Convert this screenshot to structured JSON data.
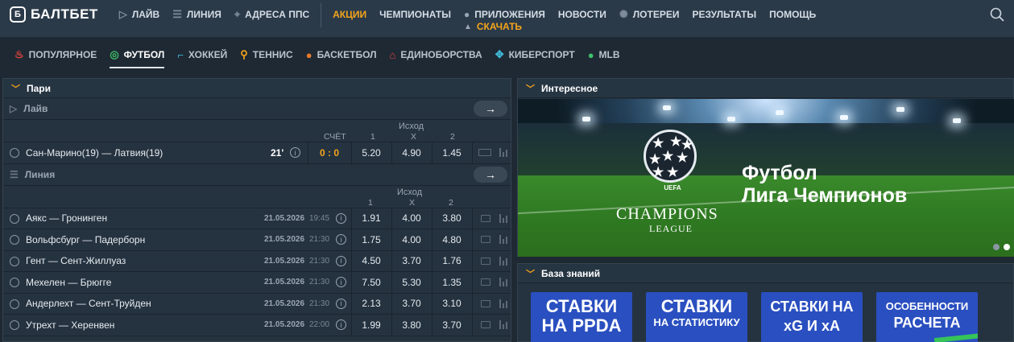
{
  "brand": {
    "logo_letter": "Б",
    "name": "БАЛТБЕТ"
  },
  "topnav": {
    "items": [
      {
        "icon": "play-circle-icon",
        "label": "ЛАЙВ"
      },
      {
        "icon": "list-icon",
        "label": "ЛИНИЯ"
      },
      {
        "icon": "map-pin-icon",
        "label": "АДРЕСА ППС"
      }
    ],
    "items2": [
      {
        "label": "АКЦИИ",
        "accent": true
      },
      {
        "label": "ЧЕМПИОНАТЫ",
        "accent": false
      }
    ],
    "apps": {
      "label": "ПРИЛОЖЕНИЯ",
      "download": "СКАЧАТЬ"
    },
    "items3": [
      {
        "label": "НОВОСТИ"
      },
      {
        "label": "ЛОТЕРЕИ"
      },
      {
        "label": "РЕЗУЛЬТАТЫ"
      },
      {
        "label": "ПОМОЩЬ"
      }
    ]
  },
  "sports": [
    {
      "label": "ПОПУЛЯРНОЕ",
      "icon": "fire-icon",
      "color": "#e8453c",
      "active": false
    },
    {
      "label": "ФУТБОЛ",
      "icon": "soccer-ball-icon",
      "color": "#3fbf6a",
      "active": true
    },
    {
      "label": "ХОККЕЙ",
      "icon": "hockey-icon",
      "color": "#3fb8d8",
      "active": false
    },
    {
      "label": "ТЕННИС",
      "icon": "tennis-racket-icon",
      "color": "#f4a51c",
      "active": false
    },
    {
      "label": "БАСКЕТБОЛ",
      "icon": "basketball-icon",
      "color": "#e87a2c",
      "active": false
    },
    {
      "label": "ЕДИНОБОРСТВА",
      "icon": "combat-icon",
      "color": "#e8453c",
      "active": false
    },
    {
      "label": "КИБЕРСПОРТ",
      "icon": "cybersport-icon",
      "color": "#3fb8d8",
      "active": false
    },
    {
      "label": "MLB",
      "icon": "baseball-icon",
      "color": "#3fbf6a",
      "active": false
    }
  ],
  "bets": {
    "title": "Пари",
    "live": {
      "label": "Лайв",
      "cols": {
        "score": "СЧЁТ",
        "c1": "1",
        "outcome": "Исход",
        "cx": "X",
        "c2": "2"
      },
      "match": {
        "name": "Сан-Марино(19) — Латвия(19)",
        "minute": "21'",
        "score": "0 : 0",
        "o1": "5.20",
        "ox": "4.90",
        "o2": "1.45"
      }
    },
    "line": {
      "label": "Линия",
      "cols": {
        "c1": "1",
        "outcome": "Исход",
        "cx": "X",
        "c2": "2"
      },
      "matches": [
        {
          "name": "Аякс — Гронинген",
          "date": "21.05.2026",
          "time": "19:45",
          "o1": "1.91",
          "ox": "4.00",
          "o2": "3.80"
        },
        {
          "name": "Вольфсбург — Падерборн",
          "date": "21.05.2026",
          "time": "21:30",
          "o1": "1.75",
          "ox": "4.00",
          "o2": "4.80"
        },
        {
          "name": "Гент — Сент-Жиллуаз",
          "date": "21.05.2026",
          "time": "21:30",
          "o1": "4.50",
          "ox": "3.70",
          "o2": "1.76"
        },
        {
          "name": "Мехелен — Брюгге",
          "date": "21.05.2026",
          "time": "21:30",
          "o1": "7.50",
          "ox": "5.30",
          "o2": "1.35"
        },
        {
          "name": "Андерлехт — Сент-Труйден",
          "date": "21.05.2026",
          "time": "21:30",
          "o1": "2.13",
          "ox": "3.70",
          "o2": "3.10"
        },
        {
          "name": "Утрехт — Херенвен",
          "date": "21.05.2026",
          "time": "22:00",
          "o1": "1.99",
          "ox": "3.80",
          "o2": "3.70"
        }
      ]
    }
  },
  "interesting": {
    "title": "Интересное",
    "banner": {
      "uefa": "UEFA",
      "champions": "CHAMPIONS",
      "league": "LEAGUE",
      "title_line1": "Футбол",
      "title_line2": "Лига Чемпионов"
    }
  },
  "knowledge": {
    "title": "База знаний",
    "cards": [
      {
        "line1": "СТАВКИ",
        "line2": "НА PPDA"
      },
      {
        "line1": "СТАВКИ",
        "line2": "НА СТАТИСТИКУ"
      },
      {
        "line1": "СТАВКИ НА",
        "line2": "xG И xA"
      },
      {
        "line1": "ОСОБЕННОСТИ",
        "line2": "РАСЧЕТА"
      }
    ]
  }
}
